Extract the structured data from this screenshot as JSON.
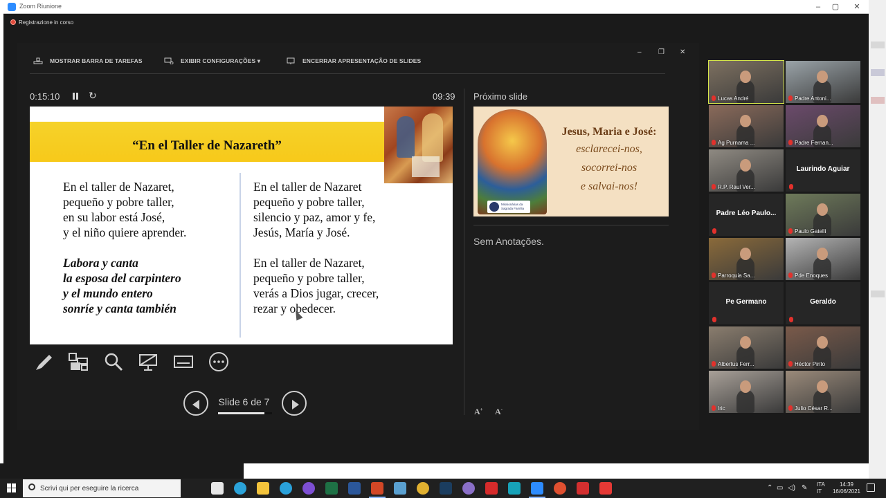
{
  "window": {
    "title": "Zoom Riunione",
    "recording": "Registrazione in corso"
  },
  "toolbar": {
    "show_taskbar": "MOSTRAR BARRA DE TAREFAS",
    "display_settings": "EXIBIR CONFIGURAÇÕES ▾",
    "end_slideshow": "ENCERRAR APRESENTAÇÃO DE SLIDES"
  },
  "presenter": {
    "elapsed": "0:15:10",
    "clock": "09:39",
    "next_slide_label": "Próximo slide",
    "notes": "Sem Anotações.",
    "slide_counter": "Slide 6 de 7",
    "slide_index": 6,
    "slide_total": 7
  },
  "current_slide": {
    "title": "“En el Taller de Nazareth”",
    "left_verse_1": "En el taller de Nazaret,\npequeño y pobre taller,\nen su labor está José,\ny el niño quiere aprender.",
    "left_verse_2": "Labora y canta\nla esposa del carpintero\ny el mundo entero\nsonríe y canta también",
    "right_verse_1": "En el taller de Nazaret\npequeño y pobre taller,\nsilencio y paz, amor y fe,\nJesús, María y José.",
    "right_verse_2": "En el taller de Nazaret,\npequeño y pobre taller,\nverás a Dios jugar, crecer,\nrezar y obedecer."
  },
  "next_slide": {
    "title": "Jesus, Maria e José:",
    "line1": "esclarecei-nos,",
    "line2": "socorrei-nos",
    "line3": "e salvai-nos!",
    "logo_text": "Missionárias da Sagrada Família"
  },
  "participants": [
    {
      "name": "Lucas André",
      "video": true,
      "active": true,
      "bg": "#7d7060"
    },
    {
      "name": "Padre Antoni...",
      "video": true,
      "active": false,
      "bg": "#9aa3a8"
    },
    {
      "name": "Ag Purnama ...",
      "video": true,
      "active": false,
      "bg": "#8a6a5a"
    },
    {
      "name": "Padre Fernan...",
      "video": true,
      "active": false,
      "bg": "#6b4a6b"
    },
    {
      "name": "R.P. Raul Ver...",
      "video": true,
      "active": false,
      "bg": "#8f8a82"
    },
    {
      "name": "Laurindo Aguiar",
      "video": false,
      "active": false,
      "bg": "#262626"
    },
    {
      "name": "Padre Léo Paulo...",
      "video": false,
      "active": false,
      "bg": "#262626"
    },
    {
      "name": "Paulo Gatelli",
      "video": true,
      "active": false,
      "bg": "#6e7a5a"
    },
    {
      "name": "Parroquia Sa...",
      "video": true,
      "active": false,
      "bg": "#8a6a3a"
    },
    {
      "name": "Pde Enoques",
      "video": true,
      "active": false,
      "bg": "#b4b4b4"
    },
    {
      "name": "Pe Germano",
      "video": false,
      "active": false,
      "bg": "#262626"
    },
    {
      "name": "Geraldo",
      "video": false,
      "active": false,
      "bg": "#262626"
    },
    {
      "name": "Albertus Ferr...",
      "video": true,
      "active": false,
      "bg": "#8a7d6e"
    },
    {
      "name": "Héctor Pinto",
      "video": true,
      "active": false,
      "bg": "#7a5a4a"
    },
    {
      "name": "Iric",
      "video": true,
      "active": false,
      "bg": "#a8a098"
    },
    {
      "name": "Julio César R...",
      "video": true,
      "active": false,
      "bg": "#9a8a7a"
    }
  ],
  "taskbar": {
    "search_placeholder": "Scrivi qui per eseguire la ricerca",
    "lang_line1": "ITA",
    "lang_line2": "IT",
    "time": "14:39",
    "date": "16/06/2021",
    "apps": [
      {
        "name": "task-view-icon",
        "color": "#202020"
      },
      {
        "name": "store-icon",
        "color": "#e6e6e6"
      },
      {
        "name": "edge-icon",
        "color": "#2ba3d9"
      },
      {
        "name": "file-explorer-icon",
        "color": "#f3c33b"
      },
      {
        "name": "telegram-icon",
        "color": "#2aa1da"
      },
      {
        "name": "app-purple-icon",
        "color": "#7d4fd3"
      },
      {
        "name": "excel-icon",
        "color": "#1e7145"
      },
      {
        "name": "word-icon",
        "color": "#2b579a"
      },
      {
        "name": "powerpoint-icon",
        "color": "#d24726"
      },
      {
        "name": "photos-icon",
        "color": "#5aa0d0"
      },
      {
        "name": "chrome-icon",
        "color": "#e0b030"
      },
      {
        "name": "photoshop-icon",
        "color": "#1b3d5f"
      },
      {
        "name": "app-f-icon",
        "color": "#8a6fc7"
      },
      {
        "name": "app-red-icon",
        "color": "#d62b2b"
      },
      {
        "name": "app-teal-icon",
        "color": "#17a2b8"
      },
      {
        "name": "zoom-icon",
        "color": "#2d8cff"
      },
      {
        "name": "chrome-2-icon",
        "color": "#e05030"
      },
      {
        "name": "app-acrobat-icon",
        "color": "#d32f2f"
      },
      {
        "name": "app-red-2-icon",
        "color": "#e53935"
      }
    ]
  }
}
